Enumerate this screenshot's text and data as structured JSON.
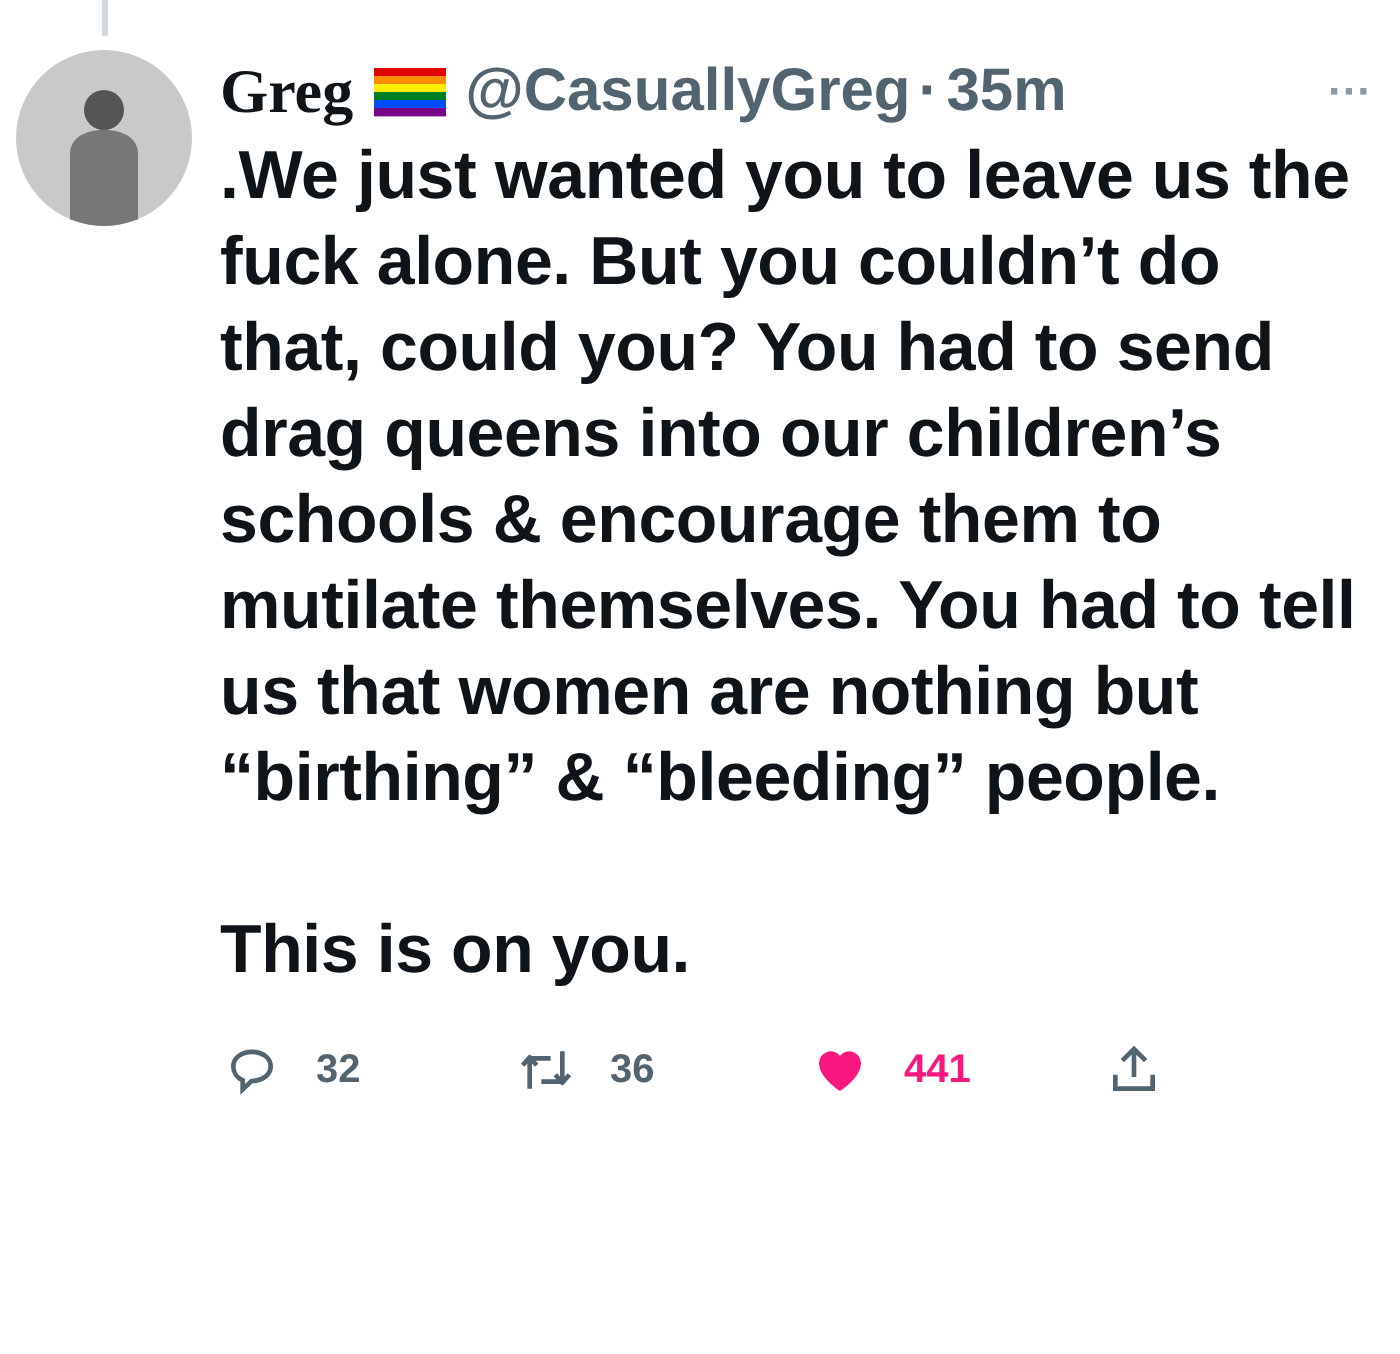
{
  "tweet": {
    "name": "Greg",
    "handle": "@CasuallyGreg",
    "separator": "·",
    "time": "35m",
    "more": "···",
    "paragraphs": [
      ".We just wanted you to leave us the fuck alone. But you couldn’t do that, could you? You had to send drag queens into our children’s schools & encourage them to mutilate themselves. You had to tell us that women are nothing but “birthing” & “bleeding” people.",
      "This is on you."
    ],
    "actions": [
      {
        "kind": "reply",
        "count": "32",
        "selected": false
      },
      {
        "kind": "retweet",
        "count": "36",
        "selected": false
      },
      {
        "kind": "like",
        "count": "441",
        "selected": true
      },
      {
        "kind": "share",
        "selected": false
      }
    ]
  }
}
